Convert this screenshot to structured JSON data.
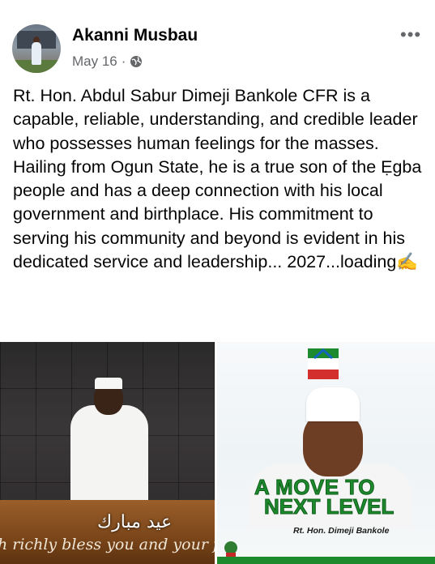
{
  "post": {
    "author": "Akanni Musbau",
    "date": "May 16",
    "separator": "·",
    "privacy_icon": "globe-icon",
    "more_label": "•••",
    "text": "Rt. Hon. Abdul Sabur Dimeji Bankole CFR is a capable, reliable, understanding, and credible leader who possesses human feelings for the masses. Hailing from Ogun State, he is a true son of the Ẹgba people and has a deep connection with his local government and birthplace. His commitment to serving his community and beyond is evident in his dedicated service and leadership... 2027...loading✍️"
  },
  "images": {
    "left": {
      "arabic_text": "عيد مبارك",
      "caption": "h richly bless you and your family. Eid"
    },
    "right": {
      "party": "APC",
      "slogan_line1": "A MOVE TO",
      "slogan_line2": "NEXT LEVEL",
      "name": "Rt. Hon. Dimeji Bankole"
    }
  },
  "colors": {
    "text": "#050505",
    "muted": "#65676b",
    "green": "#1e8a2e"
  }
}
